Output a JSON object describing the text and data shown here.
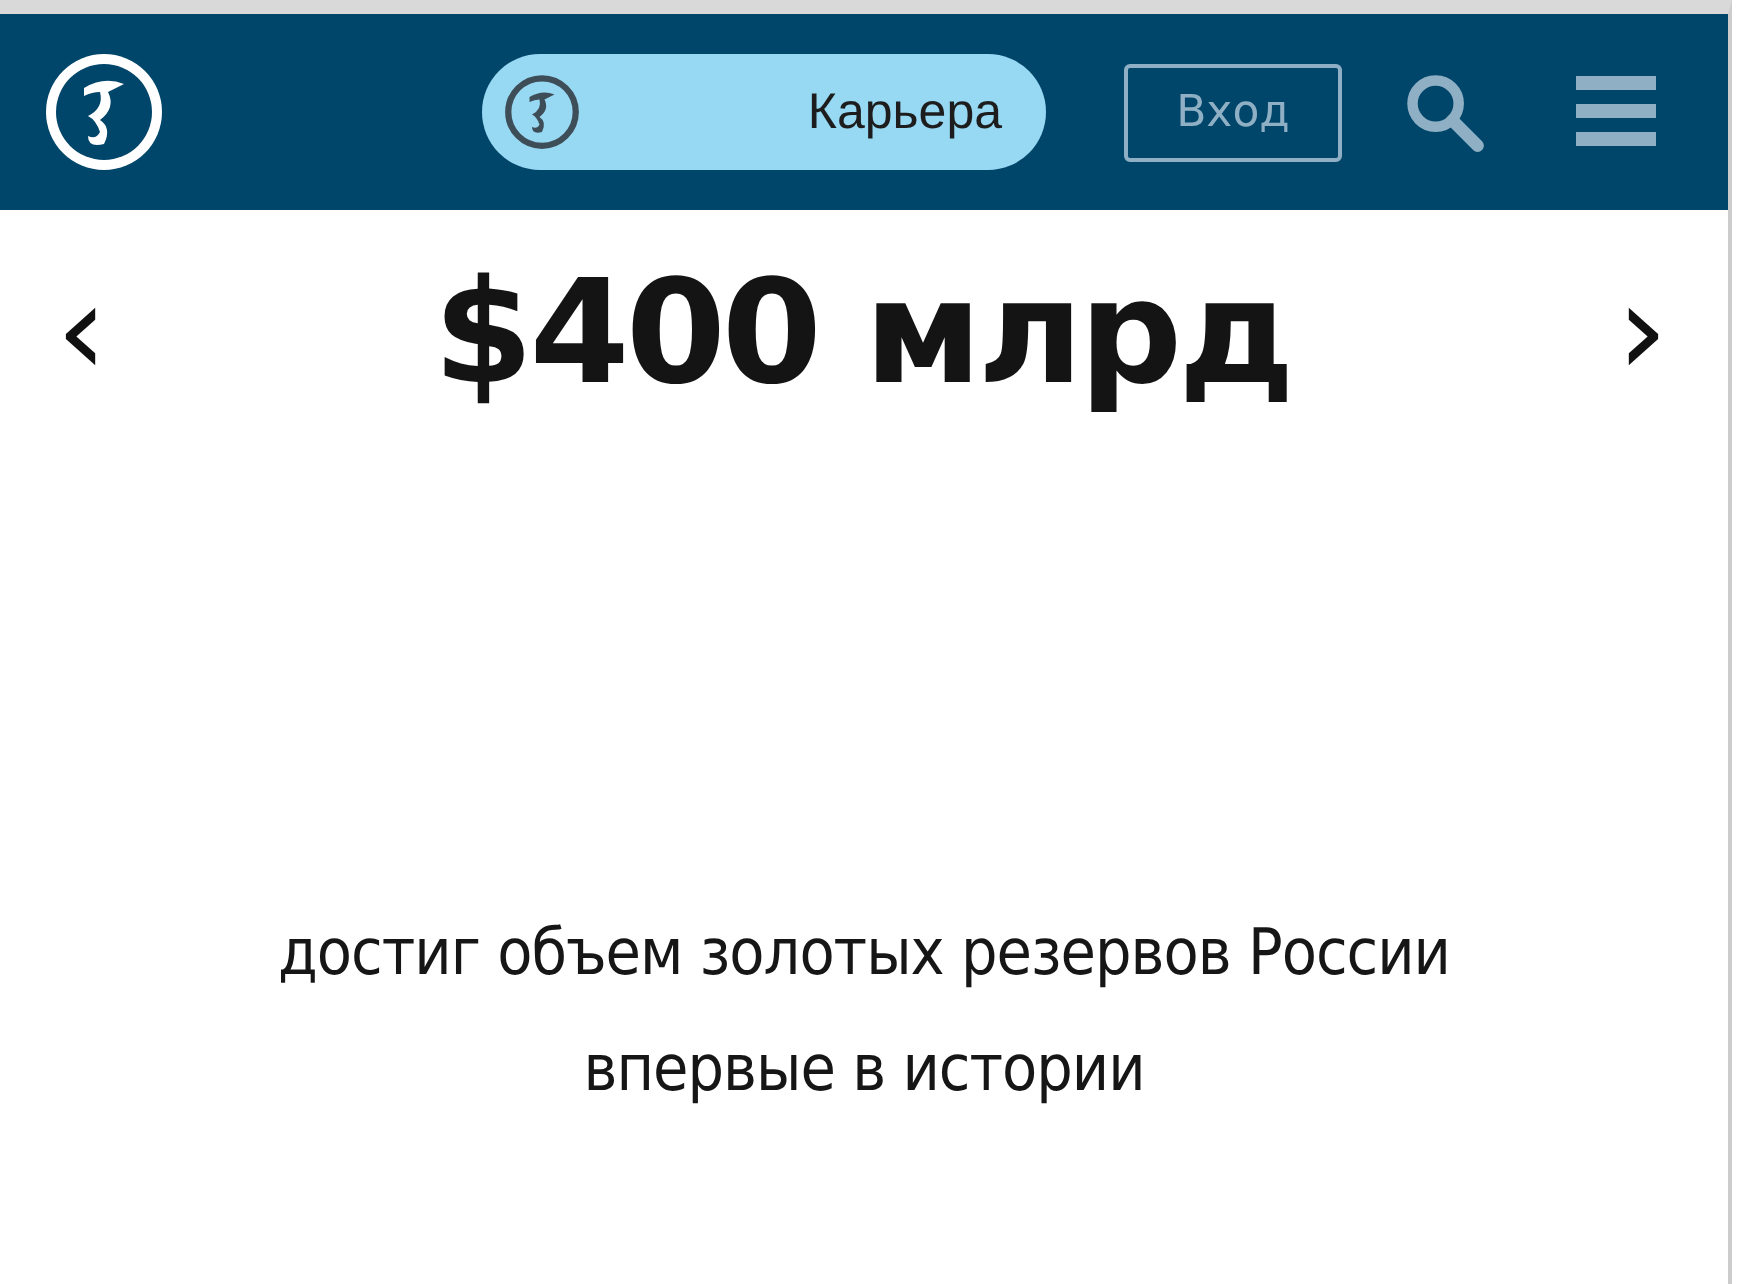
{
  "header": {
    "career_pill": {
      "label": "Карьера"
    },
    "login_button": {
      "label": "Вход"
    }
  },
  "slide": {
    "prev": "‹",
    "value": "$400 млрд",
    "next": "›",
    "caption": "достиг объем золотых резервов России впервые в истории"
  }
}
